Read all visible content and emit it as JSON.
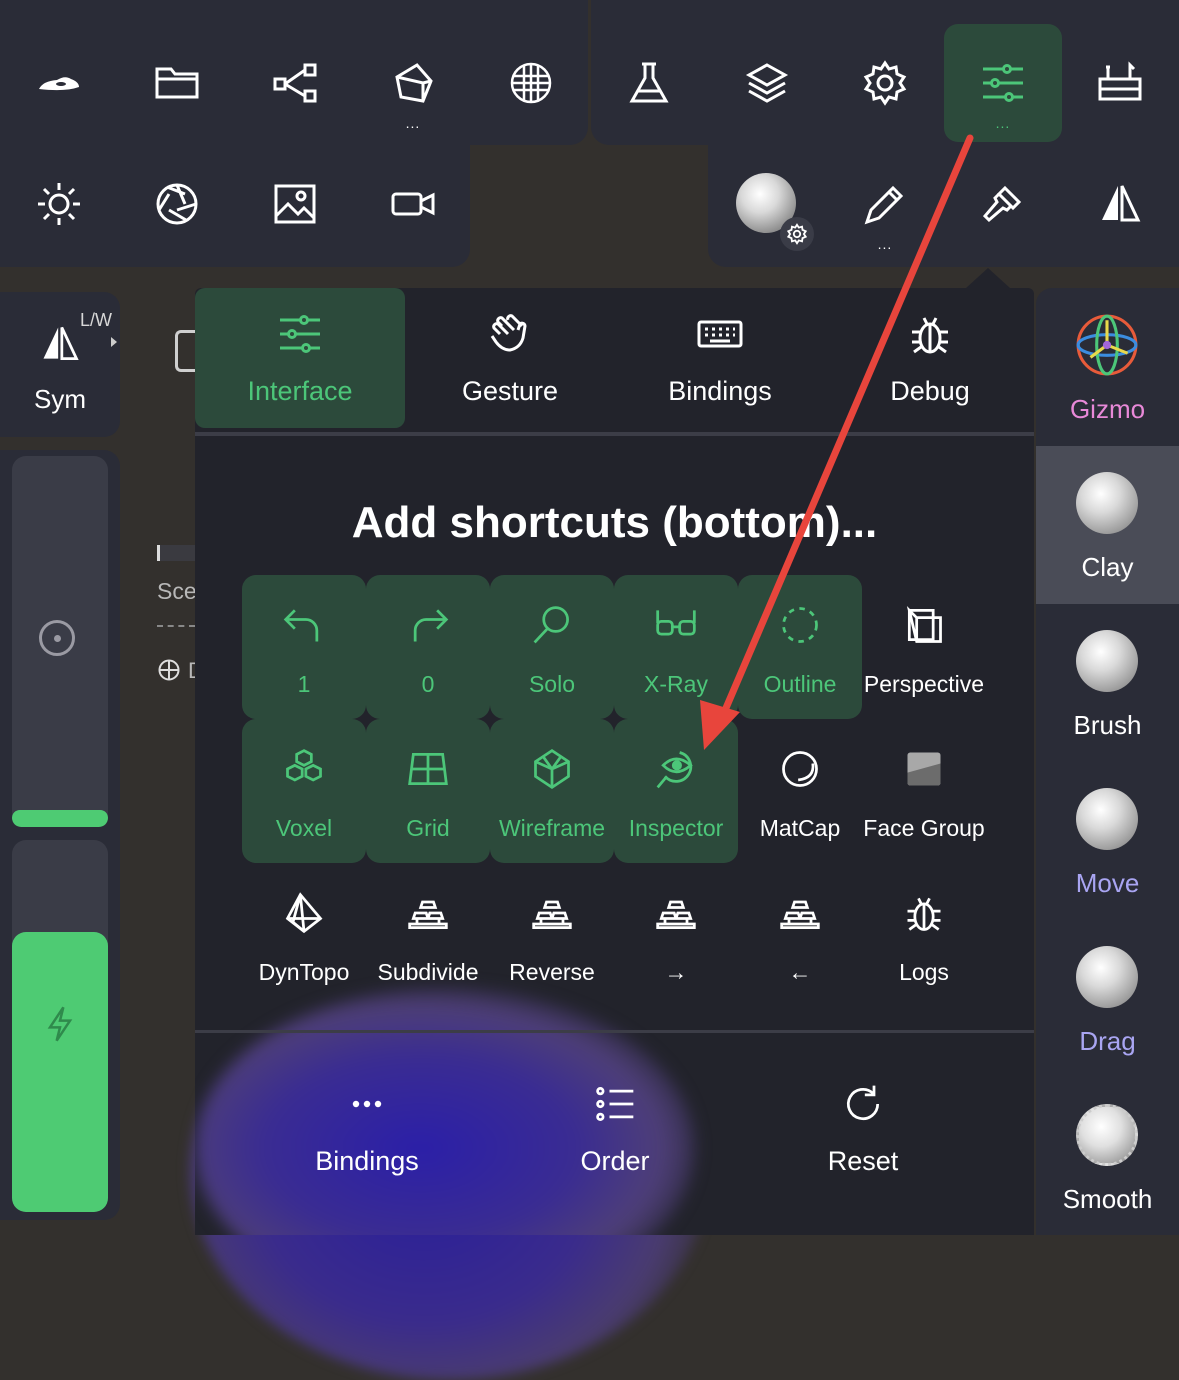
{
  "top_toolbar": {
    "row1": [
      {
        "name": "logo-icon"
      },
      {
        "name": "folder-icon"
      },
      {
        "name": "scene-graph-icon"
      },
      {
        "name": "polygon-icon",
        "has_more": true,
        "more": "..."
      },
      {
        "name": "wireframe-sphere-icon"
      },
      {
        "name": "flask-icon"
      },
      {
        "name": "layers-icon"
      },
      {
        "name": "gear-icon"
      },
      {
        "name": "sliders-icon",
        "has_more": true,
        "more": "...",
        "active": true
      },
      {
        "name": "toolbox-icon"
      }
    ],
    "row2": [
      {
        "name": "sun-icon"
      },
      {
        "name": "aperture-icon"
      },
      {
        "name": "image-icon"
      },
      {
        "name": "video-camera-icon"
      },
      {
        "name": "material-ball-icon"
      },
      {
        "name": "pen-icon",
        "has_more": true,
        "more": "..."
      },
      {
        "name": "paint-brush-icon"
      },
      {
        "name": "symmetry-icon"
      }
    ]
  },
  "left_panel": {
    "sym_label": "Sym",
    "lw_label": "L/W",
    "partial_labels": [
      "Sce",
      "D"
    ]
  },
  "right_tools": [
    {
      "label": "Gizmo",
      "color": "#e889d8"
    },
    {
      "label": "Clay",
      "color": "#ffffff",
      "selected": true
    },
    {
      "label": "Brush",
      "color": "#ffffff"
    },
    {
      "label": "Move",
      "color": "#a9a5f2"
    },
    {
      "label": "Drag",
      "color": "#a9a5f2"
    },
    {
      "label": "Smooth",
      "color": "#ffffff"
    }
  ],
  "popup": {
    "tabs": [
      {
        "label": "Interface",
        "icon": "sliders-icon",
        "active": true
      },
      {
        "label": "Gesture",
        "icon": "hand-wave-icon"
      },
      {
        "label": "Bindings",
        "icon": "keyboard-icon"
      },
      {
        "label": "Debug",
        "icon": "bug-icon"
      }
    ],
    "title": "Add shortcuts (bottom)...",
    "shortcuts": [
      {
        "label": "1",
        "icon": "undo-icon",
        "on": true
      },
      {
        "label": "0",
        "icon": "redo-icon",
        "on": true
      },
      {
        "label": "Solo",
        "icon": "magnifier-icon",
        "on": true
      },
      {
        "label": "X-Ray",
        "icon": "xray-glasses-icon",
        "on": true
      },
      {
        "label": "Outline",
        "icon": "dashed-circle-icon",
        "on": true
      },
      {
        "label": "Perspective",
        "icon": "perspective-box-icon",
        "on": false
      },
      {
        "label": "Voxel",
        "icon": "voxel-cubes-icon",
        "on": true
      },
      {
        "label": "Grid",
        "icon": "grid-plane-icon",
        "on": true
      },
      {
        "label": "Wireframe",
        "icon": "wireframe-icon",
        "on": true
      },
      {
        "label": "Inspector",
        "icon": "inspector-eye-icon",
        "on": true
      },
      {
        "label": "MatCap",
        "icon": "matcap-circle-icon",
        "on": false
      },
      {
        "label": "Face Group",
        "icon": "face-group-icon",
        "on": false
      },
      {
        "label": "DynTopo",
        "icon": "dyntopo-icon",
        "on": false
      },
      {
        "label": "Subdivide",
        "icon": "stack-icon",
        "on": false
      },
      {
        "label": "Reverse",
        "icon": "stack-icon",
        "on": false
      },
      {
        "label": "→",
        "icon": "stack-icon",
        "on": false
      },
      {
        "label": "←",
        "icon": "stack-icon",
        "on": false
      },
      {
        "label": "Logs",
        "icon": "bug-icon",
        "on": false
      }
    ],
    "bottom_buttons": [
      {
        "label": "Bindings",
        "icon": "more-dots-icon"
      },
      {
        "label": "Order",
        "icon": "list-order-icon"
      },
      {
        "label": "Reset",
        "icon": "reset-icon"
      }
    ]
  },
  "colors": {
    "accent_green": "#4cc679",
    "active_bg": "#2c4a3b",
    "panel": "#2a2c37",
    "popup": "#22232b",
    "annotation_arrow": "#e8453c"
  }
}
